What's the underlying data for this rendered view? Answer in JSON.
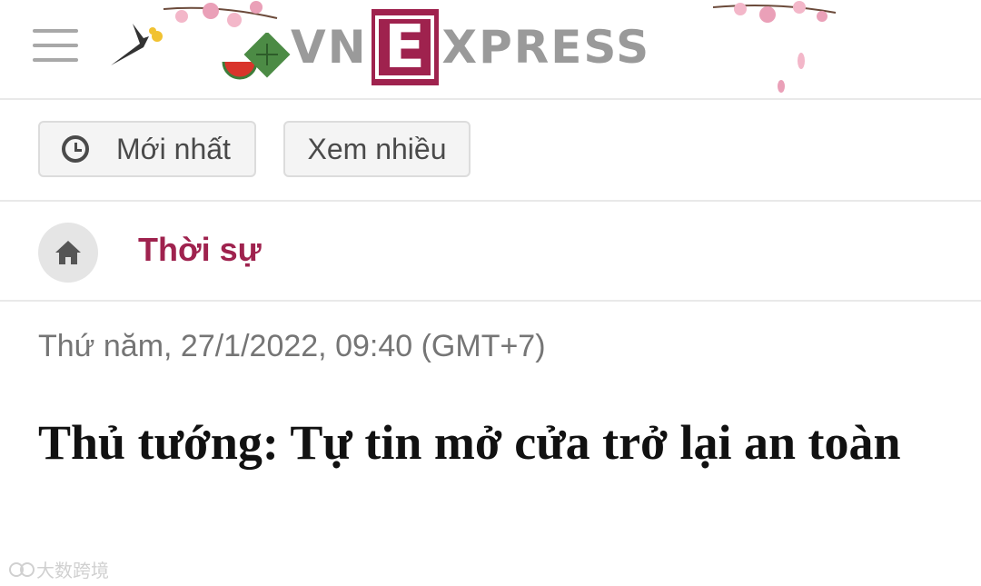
{
  "header": {
    "logo": {
      "prefix": "VN",
      "letter": "E",
      "suffix": "XPRESS"
    }
  },
  "tabs": [
    {
      "label": "Mới nhất",
      "icon": "clock-icon"
    },
    {
      "label": "Xem nhiều"
    }
  ],
  "category": {
    "home_icon": "home-icon",
    "label": "Thời sự"
  },
  "article": {
    "date": "Thứ năm, 27/1/2022, 09:40 (GMT+7)",
    "title": "Thủ tướng: Tự tin mở cửa trở lại an toàn"
  },
  "watermark": {
    "text": "大数跨境"
  },
  "colors": {
    "brand": "#9f224e",
    "blossom": "#e8a4bb",
    "leaf": "#3e7d3a"
  }
}
